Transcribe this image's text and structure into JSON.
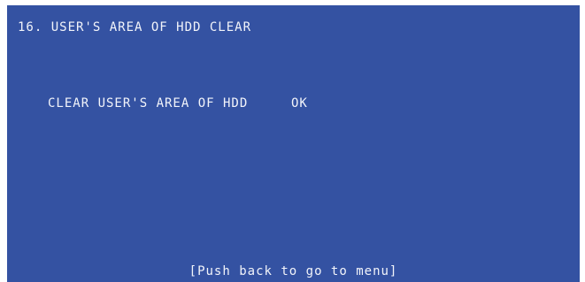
{
  "screen": {
    "title": "16. USER'S AREA OF HDD CLEAR",
    "message": "CLEAR USER'S AREA OF HDD",
    "status": "OK",
    "footer_hint": "[Push back to go to menu]",
    "background_color": "#3452a2",
    "text_color": "#f2f4fa"
  }
}
